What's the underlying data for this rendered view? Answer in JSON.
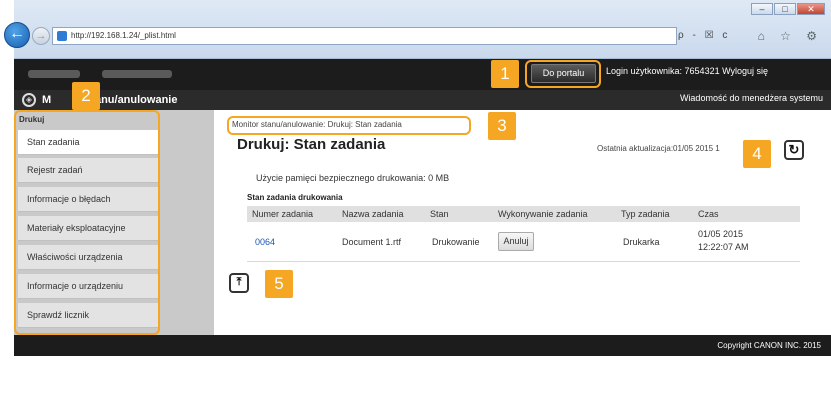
{
  "browser": {
    "url": "http://192.168.1.24/_plist.html",
    "window_controls": [
      "–",
      "□",
      "✕"
    ],
    "address_tools": "ρ - ☒ c",
    "icons": [
      "home-icon",
      "star-icon",
      "gear-icon"
    ],
    "icon_glyphs": "⌂ ☆ ⚙"
  },
  "header": {
    "portal_button": "Do portalu",
    "login": "Login użytkownika:  7654321  Wyloguj się",
    "app_title_prefix": "M",
    "app_title_suffix": "stanu/anulowanie",
    "message_link": "Wiadomość do menedżera systemu",
    "logo_glyph": "◈"
  },
  "sidebar": {
    "heading": "Drukuj",
    "items": [
      {
        "label": "Stan zadania",
        "active": true
      },
      {
        "label": "Rejestr zadań",
        "active": false
      },
      {
        "label": "Informacje o błędach",
        "active": false
      },
      {
        "label": "Materiały eksploatacyjne",
        "active": false
      },
      {
        "label": "Właściwości urządzenia",
        "active": false
      },
      {
        "label": "Informacje o urządzeniu",
        "active": false
      },
      {
        "label": "Sprawdź licznik",
        "active": false
      }
    ]
  },
  "main": {
    "breadcrumb": "Monitor stanu/anulowanie: Drukuj: Stan zadania",
    "title": "Drukuj: Stan zadania",
    "last_update": "Ostatnia aktualizacja:01/05 2015 1",
    "refresh_glyph": "↻",
    "memory": "Użycie pamięci bezpiecznego drukowania:   0 MB",
    "section_title": "Stan zadania drukowania",
    "table": {
      "headers": [
        "Numer zadania",
        "Nazwa zadania",
        "Stan",
        "Wykonywanie zadania",
        "Typ zadania",
        "Czas"
      ],
      "row": {
        "number": "0064",
        "name": "Document 1.rtf",
        "status": "Drukowanie",
        "action": "Anuluj",
        "type": "Drukarka",
        "time_date": "01/05 2015",
        "time_clock": "12:22:07 AM"
      }
    },
    "top_glyph": "⤒"
  },
  "footer": {
    "copyright": "Copyright CANON INC. 2015"
  },
  "callouts": [
    "1",
    "2",
    "3",
    "4",
    "5"
  ],
  "colors": {
    "callout": "#f5a623",
    "header_bg": "#1c1c1c",
    "sidebar_bg": "#c9c9c9",
    "link": "#1b58b8"
  }
}
